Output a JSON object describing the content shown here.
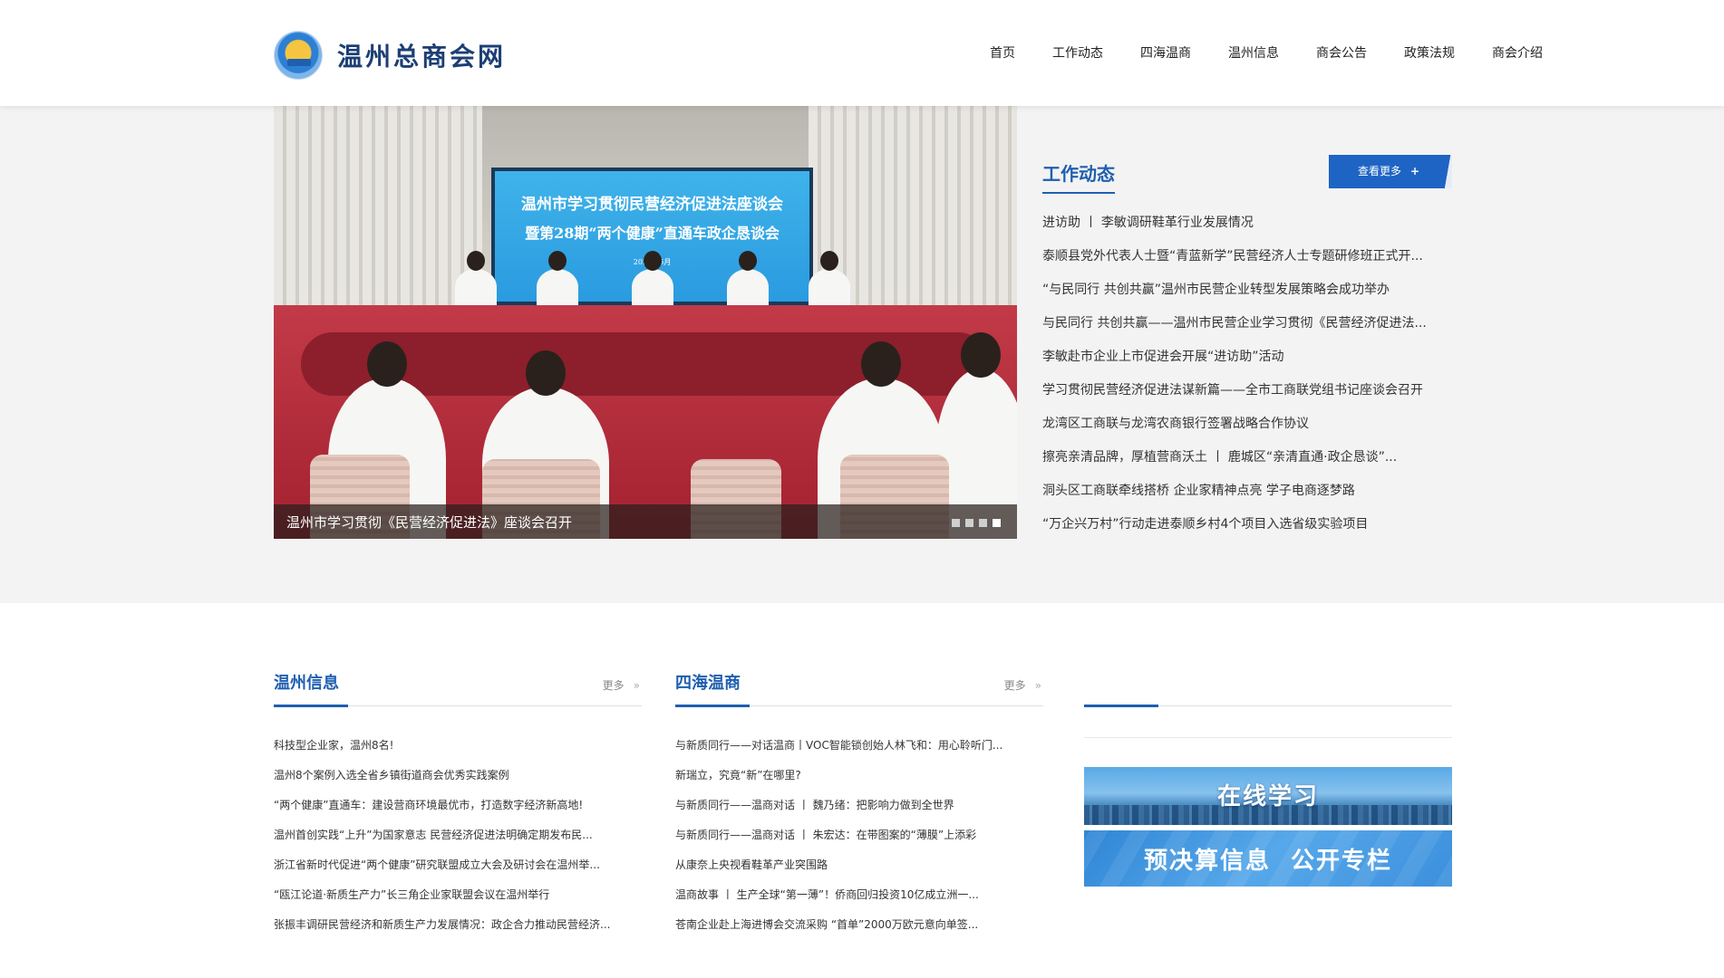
{
  "site": {
    "logo_text": "温州总商会网",
    "logo_icon": "chamber-emblem-icon"
  },
  "nav": [
    "首页",
    "工作动态",
    "四海温商",
    "温州信息",
    "商会公告",
    "政策法规",
    "商会介绍"
  ],
  "slider": {
    "screen_line1": "温州市学习贯彻民营经济促进法座谈会",
    "screen_line2": "暨第28期“两个健康”直通车政企恳谈会",
    "screen_line3": "2025年6月",
    "caption": "温州市学习贯彻《民营经济促进法》座谈会召开",
    "dots_count": 4,
    "active_dot": 4,
    "nameplates": [
      "蔡",
      "市工"
    ]
  },
  "work_news": {
    "title": "工作动态",
    "more_label": "查看更多",
    "more_icon": "plus-icon",
    "items": [
      "进访助 丨 李敏调研鞋革行业发展情况",
      "泰顺县党外代表人士暨“青蓝新学”民营经济人士专题研修班正式开...",
      "“与民同行 共创共赢”温州市民营企业转型发展策略会成功举办",
      "与民同行 共创共赢——温州市民营企业学习贯彻《民营经济促进法...",
      "李敏赴市企业上市促进会开展“进访助”活动",
      "学习贯彻民营经济促进法谋新篇——全市工商联党组书记座谈会召开",
      "龙湾区工商联与龙湾农商银行签署战略合作协议",
      "擦亮亲清品牌，厚植营商沃土 丨 鹿城区“亲清直通·政企恳谈”...",
      "洞头区工商联牵线搭桥 企业家精神点亮 学子电商逐梦路",
      "“万企兴万村”行动走进泰顺乡村4个项目入选省级实验项目"
    ]
  },
  "wenzhou_info": {
    "title": "温州信息",
    "more_label": "更多",
    "more_icon": "double-chevron-right-icon",
    "items": [
      "科技型企业家，温州8名!",
      "温州8个案例入选全省乡镇街道商会优秀实践案例",
      "“两个健康”直通车：建设营商环境最优市，打造数字经济新高地!",
      "温州首创实践“上升”为国家意志 民营经济促进法明确定期发布民...",
      "浙江省新时代促进“两个健康”研究联盟成立大会及研讨会在温州举...",
      "“瓯江论道·新质生产力”长三角企业家联盟会议在温州举行",
      "张振丰调研民营经济和新质生产力发展情况：政企合力推动民营经济..."
    ]
  },
  "sihai": {
    "title": "四海温商",
    "more_label": "更多",
    "more_icon": "double-chevron-right-icon",
    "items": [
      "与新质同行——对话温商丨VOC智能锁创始人林飞和：用心聆听门...",
      "新瑞立，究竟“新”在哪里?",
      "与新质同行——温商对话 丨 魏乃绪：把影响力做到全世界",
      "与新质同行——温商对话 丨 朱宏达：在带图案的“薄膜”上添彩",
      "从康奈上央视看鞋革产业突围路",
      "温商故事 丨 生产全球“第一薄”！侨商回归投资10亿成立洲一...",
      "苍南企业赴上海进博会交流采购 “首单”2000万欧元意向单签..."
    ]
  },
  "side_banners": [
    {
      "label": "在线学习"
    },
    {
      "label": "预决算信息  公开专栏"
    }
  ]
}
